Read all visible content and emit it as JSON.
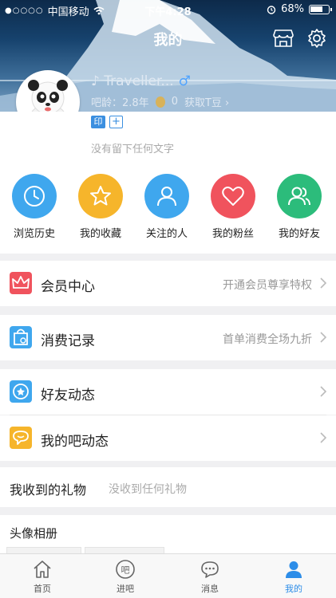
{
  "status_bar": {
    "carrier": "中国移动",
    "time": "下午4:28",
    "battery": "68%"
  },
  "header": {
    "title": "我的"
  },
  "user": {
    "name": "Traveller...",
    "gender_symbol": "♂",
    "age_label": "吧龄：2.8年",
    "beans": "0",
    "get_beans": "获取T豆",
    "badge_yin": "印",
    "badge_add": "+",
    "signature": "没有留下任何文字"
  },
  "quick_actions": [
    {
      "label": "浏览历史",
      "icon": "clock-icon",
      "color": "#3fa7ee"
    },
    {
      "label": "我的收藏",
      "icon": "star-icon",
      "color": "#f6b52b"
    },
    {
      "label": "关注的人",
      "icon": "person-icon",
      "color": "#3fa7ee"
    },
    {
      "label": "我的粉丝",
      "icon": "heart-icon",
      "color": "#f0535d"
    },
    {
      "label": "我的好友",
      "icon": "friends-icon",
      "color": "#2cbc7b"
    }
  ],
  "menu": {
    "vip": {
      "label": "会员中心",
      "hint": "开通会员尊享特权"
    },
    "consume": {
      "label": "消费记录",
      "hint": "首单消费全场九折"
    },
    "friend_feed": {
      "label": "好友动态"
    },
    "bar_feed": {
      "label": "我的吧动态"
    }
  },
  "gifts": {
    "label": "我收到的礼物",
    "hint": "没收到任何礼物"
  },
  "album": {
    "label": "头像相册"
  },
  "tabs": [
    {
      "label": "首页",
      "icon": "home-icon"
    },
    {
      "label": "进吧",
      "icon": "bar-icon"
    },
    {
      "label": "消息",
      "icon": "message-icon"
    },
    {
      "label": "我的",
      "icon": "me-icon"
    }
  ]
}
